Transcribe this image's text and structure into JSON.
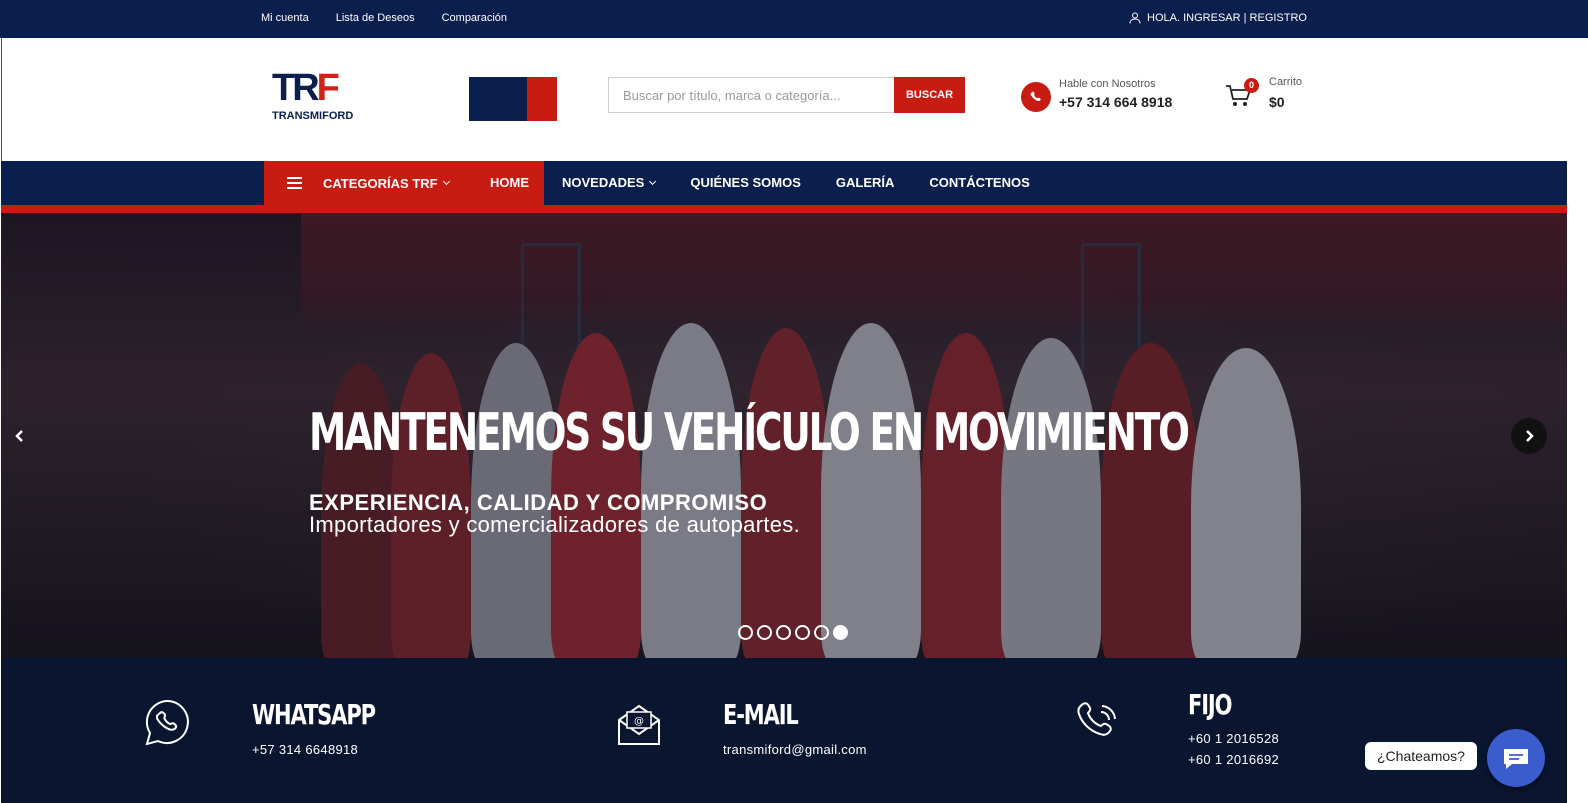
{
  "topbar": {
    "links": [
      "Mi cuenta",
      "Lista de Deseos",
      "Comparación"
    ],
    "account_label": "HOLA. INGRESAR | REGISTRO"
  },
  "header": {
    "logo_text_tr": "TR",
    "logo_text_f": "F",
    "logo_sub": "TRANSMIFORD",
    "search_placeholder": "Buscar por título, marca o categoría...",
    "search_button": "BUSCAR",
    "phone_label": "Hable con Nosotros",
    "phone_number": "+57 314 664 8918",
    "cart_label": "Carrito",
    "cart_total": "$0",
    "cart_count": "0"
  },
  "nav": {
    "categories": "CATEGORÍAS TRF",
    "home": "HOME",
    "items": [
      "NOVEDADES",
      "QUIÉNES SOMOS",
      "GALERÍA",
      "CONTÁCTENOS"
    ]
  },
  "hero": {
    "title": "MANTENEMOS SU VEHÍCULO EN MOVIMIENTO",
    "subtitle": "EXPERIENCIA, CALIDAD Y COMPROMISO",
    "text": "Importadores y comercializadores de autopartes.",
    "slide_count": 6,
    "active_slide": 6
  },
  "contacts": {
    "whatsapp_title": "WHATSAPP",
    "whatsapp_value": "+57 314 6648918",
    "email_title": "E-MAIL",
    "email_value": "transmiford@gmail.com",
    "fijo_title": "FIJO",
    "fijo_values": [
      "+60 1 2016528",
      "+60 1 2016692"
    ]
  },
  "chat": {
    "label": "¿Chateamos?"
  },
  "colors": {
    "navy": "#0a1f4e",
    "red": "#c81b12",
    "footer": "#0a1530"
  }
}
